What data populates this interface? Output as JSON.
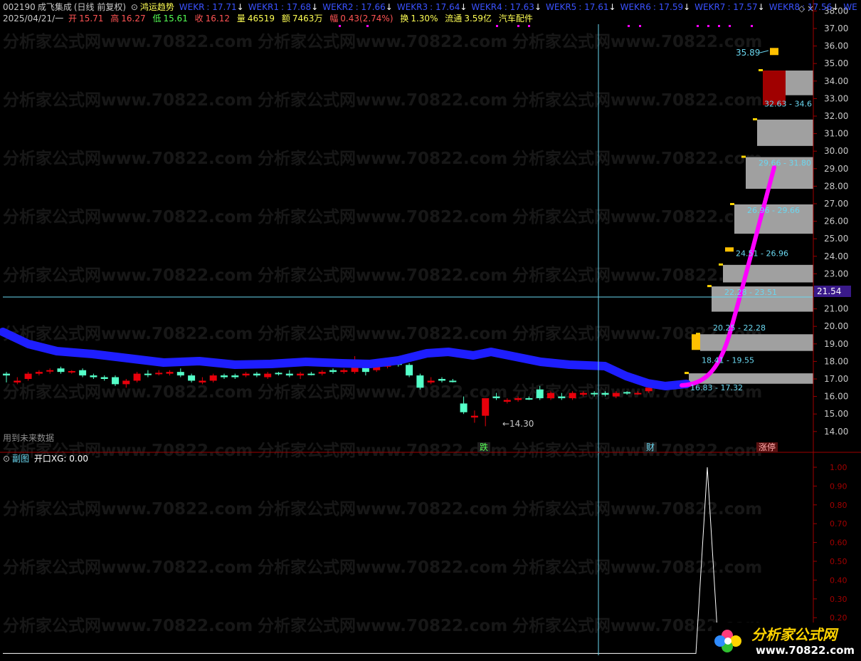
{
  "header": {
    "code": "002190",
    "name": "成飞集成",
    "period": "(日线 前复权)",
    "indicator": "鸿运趋势",
    "wekr": [
      {
        "label": "WEKR",
        "value": "17.71"
      },
      {
        "label": "WEKR1",
        "value": "17.68"
      },
      {
        "label": "WEKR2",
        "value": "17.66"
      },
      {
        "label": "WEKR3",
        "value": "17.64"
      },
      {
        "label": "WEKR4",
        "value": "17.63"
      },
      {
        "label": "WEKR5",
        "value": "17.61"
      },
      {
        "label": "WEKR6",
        "value": "17.59"
      },
      {
        "label": "WEKR7",
        "value": "17.57"
      },
      {
        "label": "WEKR8",
        "value": "17.56"
      },
      {
        "label": "WE",
        "value": ""
      }
    ],
    "date": "2025/04/21/一",
    "open_label": "开",
    "open": "15.71",
    "high_label": "高",
    "high": "16.27",
    "low_label": "低",
    "low": "15.61",
    "close_label": "收",
    "close": "16.12",
    "vol_label": "量",
    "vol": "46519",
    "amount_label": "额",
    "amount": "7463万",
    "change_label": "幅",
    "change": "0.43(2.74%)",
    "turnover_label": "换",
    "turnover": "1.30%",
    "float_label": "流通",
    "float": "3.59亿",
    "sector": "汽车配件"
  },
  "labels": {
    "future_data": "用到未来数据",
    "low_mark": "14.30",
    "high_mark": "35.89",
    "die": "跌",
    "cai": "财",
    "zhangting": "涨停",
    "price_tag": "21.54"
  },
  "sub": {
    "title": "副图",
    "formula": "开口XG: 0.00"
  },
  "zones": [
    "16.83 - 17.32",
    "18.41 - 19.55",
    "20.25 - 22.28",
    "22.28 - 23.51",
    "24.51 - 26.96",
    "26.96 - 29.66",
    "29.66 - 31.80",
    "32.63 - 34.6"
  ],
  "price_axis": [
    "38.00",
    "37.00",
    "36.00",
    "35.00",
    "34.00",
    "33.00",
    "32.00",
    "31.00",
    "30.00",
    "29.00",
    "28.00",
    "27.00",
    "26.00",
    "25.00",
    "24.00",
    "23.00",
    "22.00",
    "21.00",
    "20.00",
    "19.00",
    "18.00",
    "17.00",
    "16.00",
    "15.00",
    "14.00"
  ],
  "sub_axis": [
    "1.00",
    "0.90",
    "0.80",
    "0.70",
    "0.60",
    "0.50",
    "0.40",
    "0.30",
    "0.20"
  ],
  "watermark": "分析家公式网www.70822.com",
  "logo": {
    "brand": "分析家公式网",
    "url": "www.70822.com"
  },
  "colors": {
    "up": "#e8000b",
    "down": "#54ffc8",
    "trend": "#1e1eff",
    "projection": "#ff00ff",
    "zone": "#a0a0a0",
    "crosshair": "#6ad7f0",
    "axis": "#a00000",
    "title": "#ffff54"
  }
}
